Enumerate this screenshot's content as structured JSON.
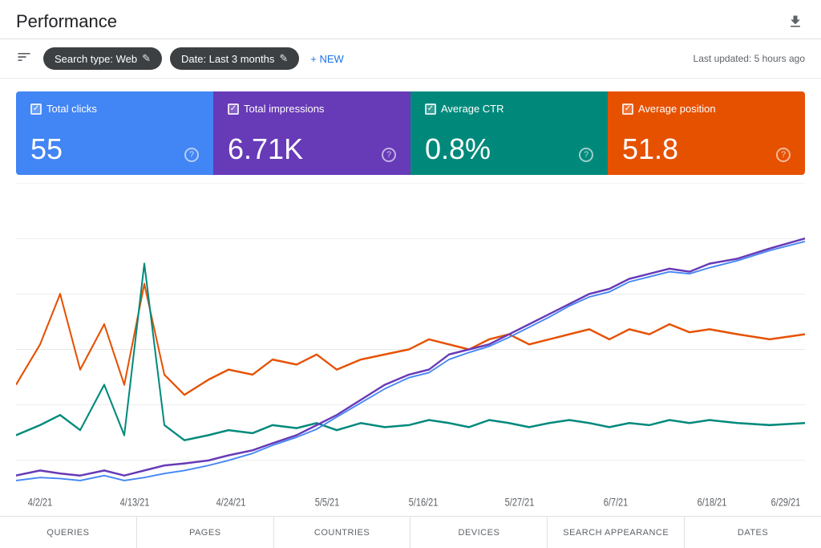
{
  "header": {
    "title": "Performance",
    "last_updated": "Last updated: 5 hours ago"
  },
  "toolbar": {
    "filter_icon": "≡",
    "search_type_chip": "Search type: Web",
    "date_chip": "Date: Last 3 months",
    "new_button": "+ NEW",
    "edit_symbol": "✎"
  },
  "metrics": [
    {
      "id": "clicks",
      "label": "Total clicks",
      "value": "55",
      "color": "#4285f4",
      "checked": true
    },
    {
      "id": "impressions",
      "label": "Total impressions",
      "value": "6.71K",
      "color": "#673ab7",
      "checked": true
    },
    {
      "id": "ctr",
      "label": "Average CTR",
      "value": "0.8%",
      "color": "#00897b",
      "checked": true
    },
    {
      "id": "position",
      "label": "Average position",
      "value": "51.8",
      "color": "#e65100",
      "checked": true
    }
  ],
  "chart": {
    "x_labels": [
      "4/2/21",
      "4/13/21",
      "4/24/21",
      "5/5/21",
      "5/16/21",
      "5/27/21",
      "6/7/21",
      "6/18/21",
      "6/29/21"
    ],
    "lines": [
      {
        "color": "#4285f4",
        "label": "Clicks"
      },
      {
        "color": "#673ab7",
        "label": "Impressions"
      },
      {
        "color": "#00897b",
        "label": "CTR"
      },
      {
        "color": "#e65100",
        "label": "Position"
      }
    ]
  },
  "bottom_tabs": [
    {
      "id": "queries",
      "label": "QUERIES",
      "active": false
    },
    {
      "id": "pages",
      "label": "PAGES",
      "active": false
    },
    {
      "id": "countries",
      "label": "COUNTRIES",
      "active": false
    },
    {
      "id": "devices",
      "label": "DEVICES",
      "active": false
    },
    {
      "id": "search_appearance",
      "label": "SEARCH APPEARANCE",
      "active": false
    },
    {
      "id": "dates",
      "label": "DATES",
      "active": false
    }
  ]
}
